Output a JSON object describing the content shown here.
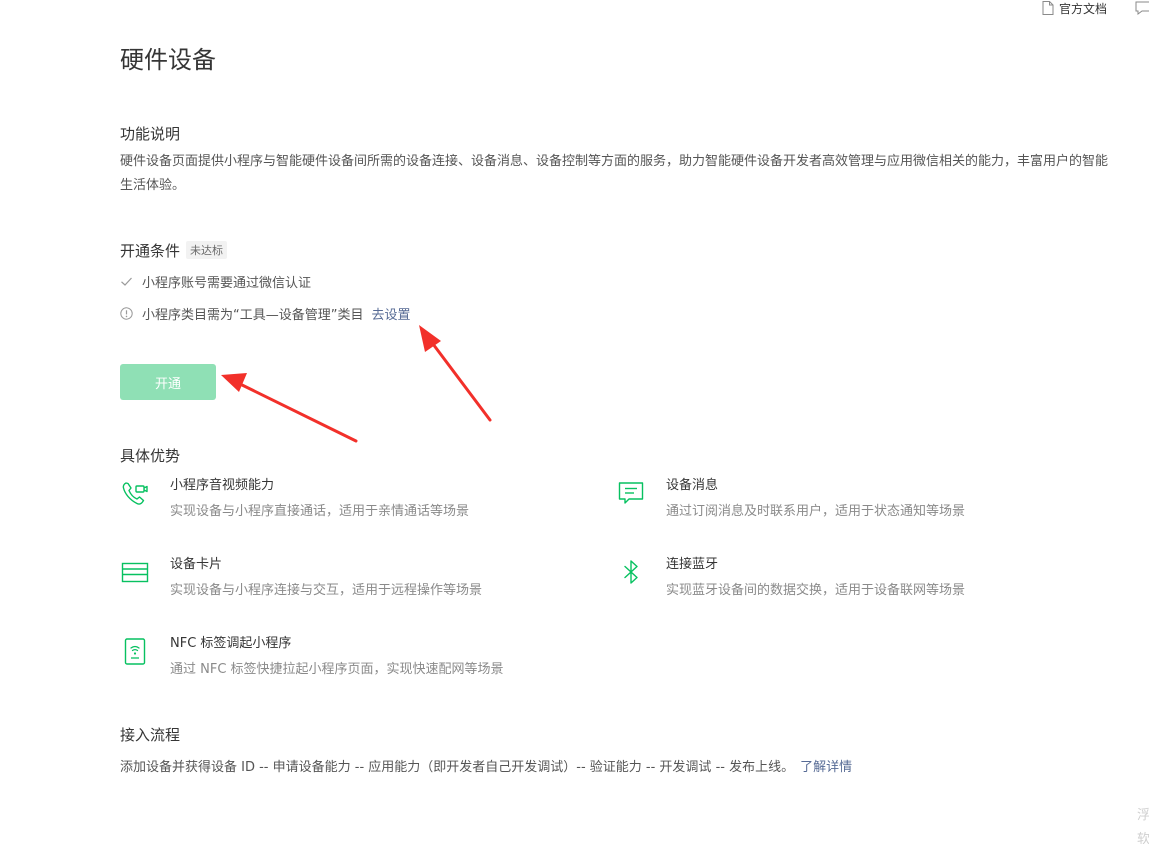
{
  "topbar": {
    "doc_label": "官方文档",
    "doc_icon": "document-icon",
    "feedback_icon": "feedback-icon"
  },
  "page_title": "硬件设备",
  "description": {
    "heading": "功能说明",
    "text": "硬件设备页面提供小程序与智能硬件设备间所需的设备连接、设备消息、设备控制等方面的服务，助力智能硬件设备开发者高效管理与应用微信相关的能力，丰富用户的智能生活体验。"
  },
  "conditions": {
    "heading": "开通条件",
    "badge": "未达标",
    "items": [
      {
        "icon": "check-icon",
        "text": "小程序账号需要通过微信认证"
      },
      {
        "icon": "info-icon",
        "text": "小程序类目需为“工具—设备管理”类目",
        "link": "去设置"
      }
    ]
  },
  "enable_button": "开通",
  "advantages": {
    "heading": "具体优势",
    "items": [
      {
        "icon": "video-call-icon",
        "title": "小程序音视频能力",
        "desc": "实现设备与小程序直接通话，适用于亲情通话等场景"
      },
      {
        "icon": "message-icon",
        "title": "设备消息",
        "desc": "通过订阅消息及时联系用户，适用于状态通知等场景"
      },
      {
        "icon": "card-icon",
        "title": "设备卡片",
        "desc": "实现设备与小程序连接与交互，适用于远程操作等场景"
      },
      {
        "icon": "bluetooth-icon",
        "title": "连接蓝牙",
        "desc": "实现蓝牙设备间的数据交换，适用于设备联网等场景"
      },
      {
        "icon": "nfc-icon",
        "title": "NFC 标签调起小程序",
        "desc": "通过 NFC 标签快捷拉起小程序页面，实现快速配网等场景"
      }
    ]
  },
  "flow": {
    "heading": "接入流程",
    "text": "添加设备并获得设备 ID -- 申请设备能力 -- 应用能力（即开发者自己开发调试）-- 验证能力 -- 开发调试 -- 发布上线。",
    "link": "了解详情"
  },
  "edge": {
    "line1": "浮",
    "line2": "软"
  },
  "colors": {
    "accent_green": "#07c160",
    "disabled_button": "#8fe0b5",
    "link_blue": "#576b95",
    "annotation_arrow": "#f2302a"
  }
}
